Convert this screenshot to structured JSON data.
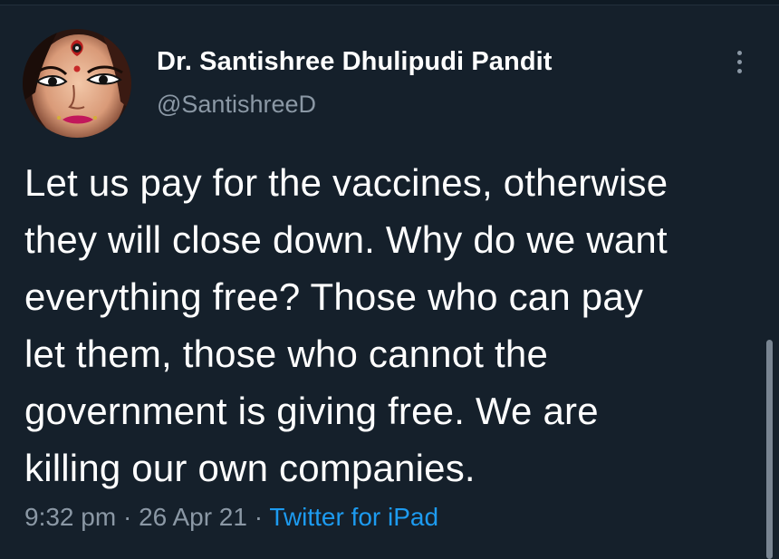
{
  "tweet": {
    "author": {
      "name": "Dr. Santishree Dhulipudi Pandit",
      "handle": "@SantishreeD",
      "avatar_icon": "avatar-image"
    },
    "text_lines": [
      "Let us pay for the vaccines, otherwise",
      "they will close down. Why do we want",
      "everything free? Those who can pay",
      "let them, those who cannot the",
      "government is giving free. We are",
      "killing our own companies."
    ],
    "time": "9:32 pm",
    "separator": "·",
    "date": "26 Apr 21",
    "source": "Twitter for iPad",
    "more_icon": "more-vertical-icon"
  },
  "colors": {
    "background": "#15202b",
    "text": "#ffffff",
    "secondary_text": "#8b98a5",
    "link": "#1d9bf0"
  }
}
